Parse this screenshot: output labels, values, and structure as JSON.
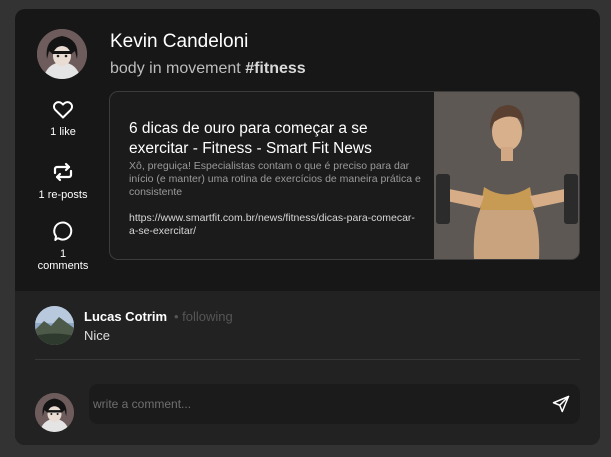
{
  "post": {
    "author": "Kevin Candeloni",
    "text": "body in movement",
    "hashtag": "#fitness",
    "likes_label": "1 like",
    "reposts_label": "1 re-posts",
    "comments_count": "1",
    "comments_label": "comments"
  },
  "link_preview": {
    "title": "6 dicas de ouro para começar a se exercitar - Fitness - Smart Fit News",
    "description": "Xô, preguiça! Especialistas contam o que é preciso para dar início (e manter) uma rotina de exercícios de maneira prática e consistente",
    "url": "https://www.smartfit.com.br/news/fitness/dicas-para-comecar-a-se-exercitar/"
  },
  "comments": [
    {
      "author": "Lucas Cotrim",
      "status": "• following",
      "text": "Nice"
    }
  ],
  "comment_input": {
    "placeholder": "write a comment..."
  },
  "icons": {
    "like": "heart-icon",
    "repost": "repost-icon",
    "comment": "comment-bubble-icon",
    "send": "send-icon"
  },
  "colors": {
    "card_bg": "#171717",
    "comments_bg": "#222222",
    "page_bg": "#333333"
  }
}
